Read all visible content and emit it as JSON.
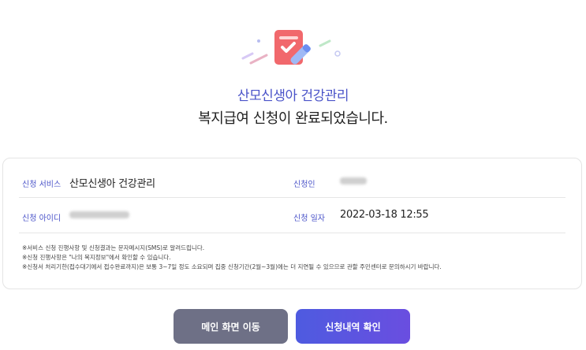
{
  "header": {
    "service_title": "산모신생아 건강관리",
    "complete_message": "복지급여 신청이 완료되었습니다."
  },
  "details": {
    "service_label": "신청 서비스",
    "service_value": "산모신생아 건강관리",
    "applicant_label": "신청인",
    "id_label": "신청 아이디",
    "date_label": "신청 일자",
    "date_value": "2022-03-18 12:55"
  },
  "notes": [
    "※서비스 신청 진행사항 및 신청결과는 문자메시지(SMS)로 알려드립니다.",
    "※신청 진행사항은 \"나의 복지정보\"에서 확인할 수 있습니다.",
    "※신청서 처리기한(접수대기에서 접수완료까지)은 보통 3~7일 정도 소요되며 집중 신청기간(2월~3월)에는 더 지연될 수 있으므로 관할 주민센터로 문의하시기 바랍니다."
  ],
  "buttons": {
    "main": "메인 화면 이동",
    "check": "신청내역 확인"
  },
  "colors": {
    "accent": "#4b54c9",
    "button_main": "#6e7086",
    "button_check": "#5a56e0"
  }
}
